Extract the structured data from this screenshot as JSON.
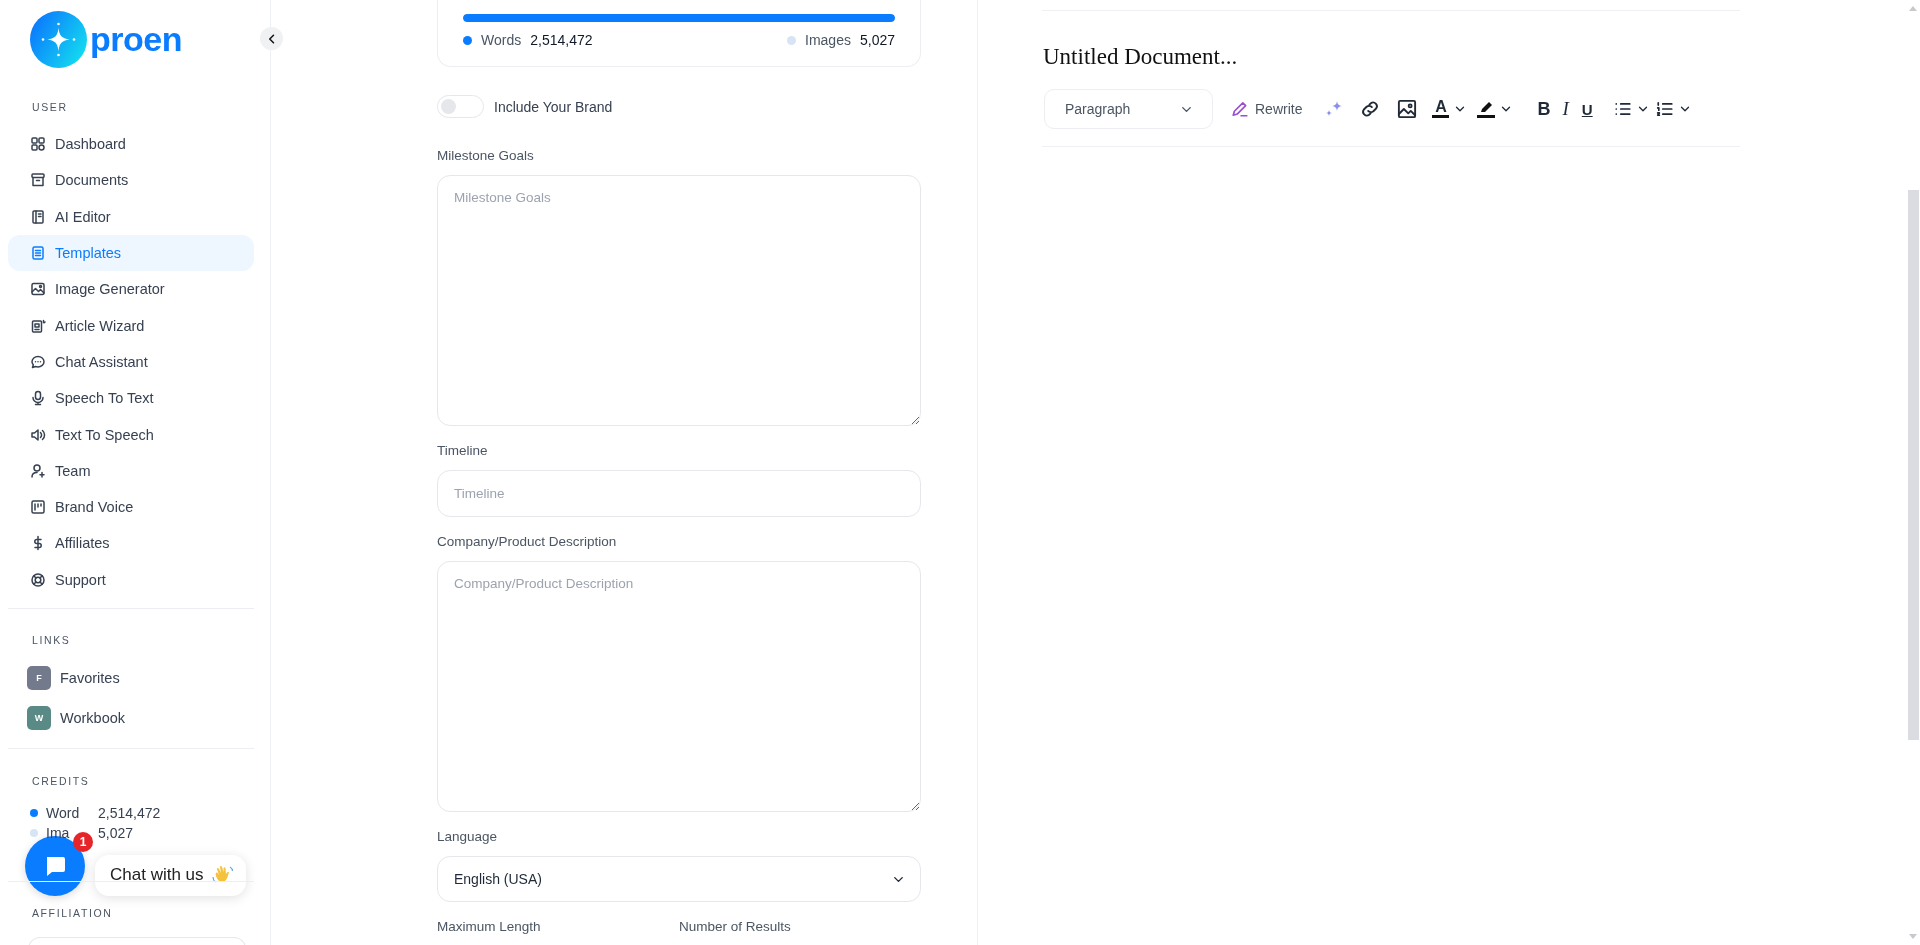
{
  "sidebar": {
    "logo": "proen",
    "user": {
      "heading": "USER",
      "items": [
        {
          "label": "Dashboard",
          "selected": false
        },
        {
          "label": "Documents",
          "selected": false
        },
        {
          "label": "AI Editor",
          "selected": false
        },
        {
          "label": "Templates",
          "selected": true
        },
        {
          "label": "Image Generator",
          "selected": false
        },
        {
          "label": "Article Wizard",
          "selected": false
        },
        {
          "label": "Chat Assistant",
          "selected": false
        },
        {
          "label": "Speech To Text",
          "selected": false
        },
        {
          "label": "Text To Speech",
          "selected": false
        },
        {
          "label": "Team",
          "selected": false
        },
        {
          "label": "Brand Voice",
          "selected": false
        },
        {
          "label": "Affiliates",
          "selected": false
        },
        {
          "label": "Support",
          "selected": false
        }
      ]
    },
    "links": {
      "heading": "LINKS",
      "items": [
        {
          "initial": "F",
          "label": "Favorites",
          "color": "#737a8c"
        },
        {
          "initial": "W",
          "label": "Workbook",
          "color": "#5a8a85"
        }
      ]
    },
    "credits": {
      "heading": "CREDITS",
      "items": [
        {
          "label": "Word",
          "value": "2,514,472",
          "color": "#0a7cff"
        },
        {
          "label": "Ima",
          "value": "5,027",
          "color": "#d6e4f5"
        }
      ]
    },
    "affiliation": {
      "heading": "AFFILIATION"
    }
  },
  "chat_widget": {
    "badge": "1",
    "label": "Chat with us"
  },
  "form": {
    "usage": {
      "level": 1,
      "items": [
        {
          "label": "Words",
          "value": "2,514,472",
          "color": "#0a7cff"
        },
        {
          "label": "Images",
          "value": "5,027",
          "color": "#d6e4f5"
        }
      ]
    },
    "brand_toggle": {
      "label": "Include Your Brand",
      "on": false
    },
    "fields": [
      {
        "kind": "textarea",
        "label": "Milestone Goals",
        "placeholder": "Milestone Goals"
      },
      {
        "kind": "input",
        "label": "Timeline",
        "placeholder": "Timeline"
      },
      {
        "kind": "textarea",
        "label": "Company/Product Description",
        "placeholder": "Company/Product Description"
      },
      {
        "kind": "select",
        "label": "Language",
        "value": "English (USA)"
      }
    ],
    "pair_labels": [
      "Maximum Length",
      "Number of Results"
    ]
  },
  "editor": {
    "title": "Untitled Document...",
    "block_style": "Paragraph",
    "rewrite": "Rewrite",
    "text_color": "A",
    "bold": "B",
    "italic": "I",
    "underline": "U"
  }
}
